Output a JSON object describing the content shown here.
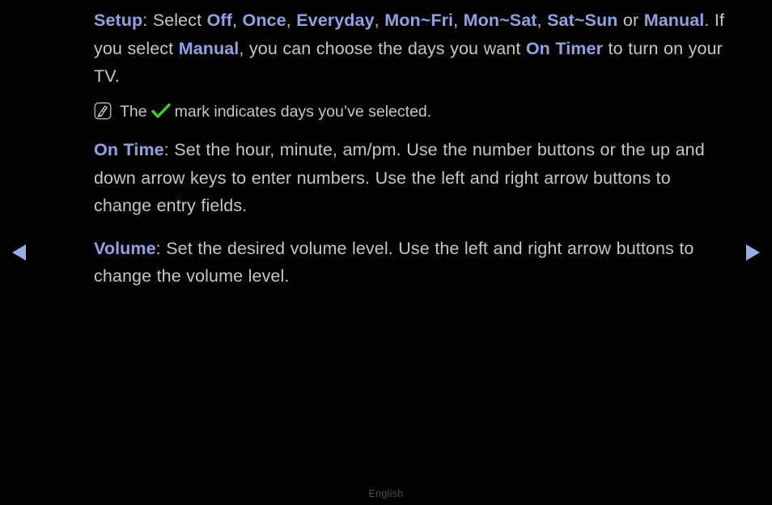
{
  "theme": {
    "background": "#000000",
    "body_text": "#c6c6c6",
    "term_highlight": "#8fa2e2",
    "check_green": "#3fd21a",
    "arrow_blue": "#9aaee6",
    "footer_text": "#4e4e4e"
  },
  "nav": {
    "prev_label": "previous-page",
    "next_label": "next-page",
    "prev_icon": "triangle-left-icon",
    "next_icon": "triangle-right-icon"
  },
  "content": {
    "setup": {
      "term": "Setup",
      "t1": ": Select ",
      "opt1": "Off",
      "t2": ", ",
      "opt2": "Once",
      "t3": ", ",
      "opt3": "Everyday",
      "t4": ", ",
      "opt4": "Mon~Fri",
      "t5": ", ",
      "opt5": "Mon~Sat",
      "t6": ", ",
      "opt6": "Sat~Sun",
      "t7": " or ",
      "opt7": "Manual",
      "t8": ". If you select ",
      "opt8": "Manual",
      "t9": ", you can choose the days you want ",
      "opt9": "On Timer",
      "t10": " to turn on your TV."
    },
    "note": {
      "icon": "note-pen-icon",
      "before": "The",
      "check_icon": "check-mark-icon",
      "after": "mark indicates days you’ve selected."
    },
    "on_time": {
      "term": "On Time",
      "text": ": Set the hour, minute, am/pm. Use the number buttons or the up and down arrow keys to enter numbers. Use the left and right arrow buttons to change entry fields."
    },
    "volume": {
      "term": "Volume",
      "text": ": Set the desired volume level. Use the left and right arrow buttons to change the volume level."
    }
  },
  "footer": {
    "language": "English"
  }
}
